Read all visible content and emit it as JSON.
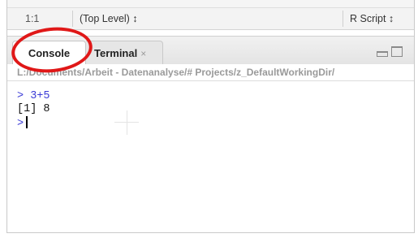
{
  "status_bar": {
    "cursor_position": "1:1",
    "scope": "(Top Level) ↕",
    "file_type": "R Script ↕"
  },
  "tabs": [
    {
      "label": "Console",
      "active": true
    },
    {
      "label": "Terminal",
      "close": "×",
      "active": false
    }
  ],
  "working_directory": "L:/Documents/Arbeit - Datenanalyse/# Projects/z_DefaultWorkingDir/",
  "console": {
    "lines": [
      "> 3+5",
      "[1] 8"
    ],
    "prompt": ">"
  },
  "colors": {
    "prompt": "#3b3bd6",
    "annotation": "#e01818"
  },
  "icons": [
    "minimize-icon",
    "maximize-icon",
    "close-icon"
  ]
}
